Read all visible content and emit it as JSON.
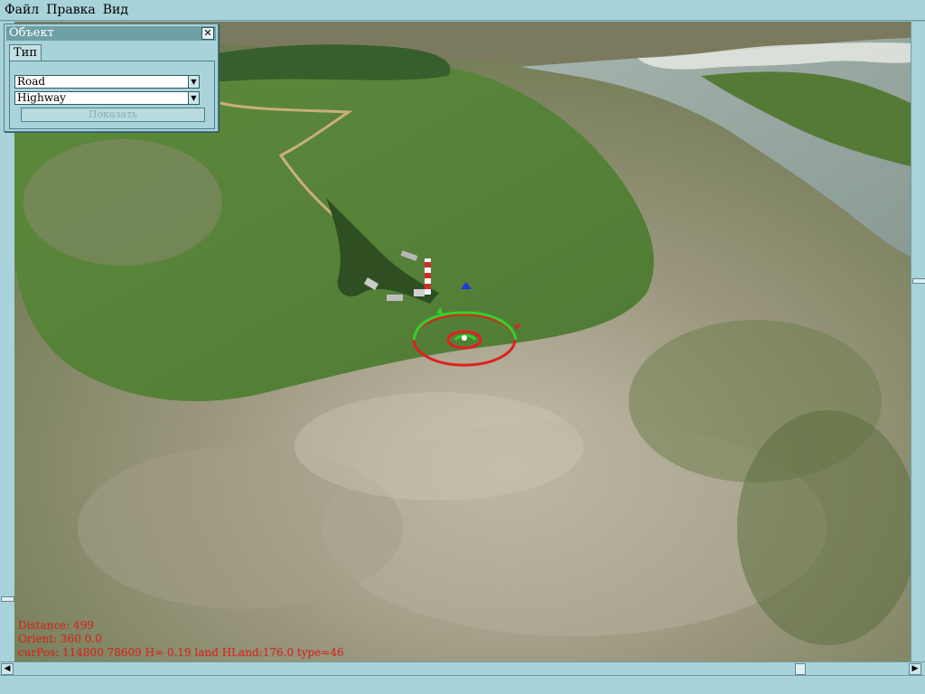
{
  "menu": {
    "items": [
      {
        "label": "Файл"
      },
      {
        "label": "Правка"
      },
      {
        "label": "Вид"
      }
    ]
  },
  "object_panel": {
    "title": "Объект",
    "tab_label": "Тип",
    "type_value": "Road",
    "subtype_value": "Highway",
    "show_button_label": "Показать",
    "close_glyph": "✕"
  },
  "hud": {
    "distance": "Distance: 499",
    "orient": "Orient: 360 0.0",
    "position": "curPos: 114800 78609 H= 0.19 land HLand:176.0 type=46"
  },
  "colors": {
    "hud_text": "#e2241c",
    "ui_background": "#a9d3da",
    "panel_title": "#6f9fa7"
  },
  "icons": {
    "dropdown": "chevron-down-icon",
    "close": "close-icon",
    "scroll_left": "arrow-left-icon",
    "scroll_right": "arrow-right-icon"
  }
}
